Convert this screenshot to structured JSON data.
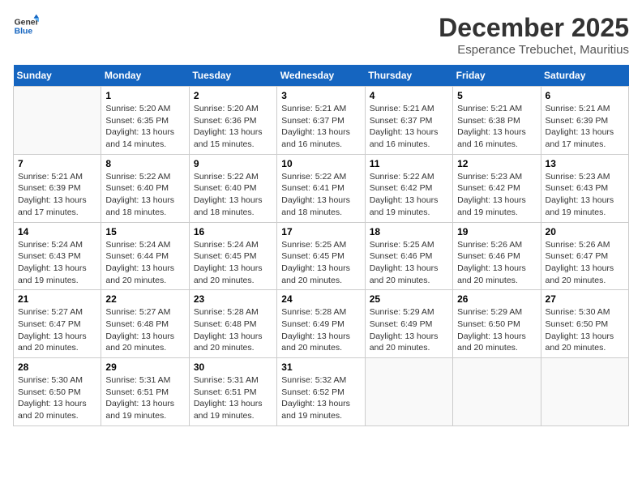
{
  "logo": {
    "line1": "General",
    "line2": "Blue"
  },
  "title": "December 2025",
  "subtitle": "Esperance Trebuchet, Mauritius",
  "weekdays": [
    "Sunday",
    "Monday",
    "Tuesday",
    "Wednesday",
    "Thursday",
    "Friday",
    "Saturday"
  ],
  "weeks": [
    [
      {
        "day": "",
        "info": ""
      },
      {
        "day": "1",
        "info": "Sunrise: 5:20 AM\nSunset: 6:35 PM\nDaylight: 13 hours\nand 14 minutes."
      },
      {
        "day": "2",
        "info": "Sunrise: 5:20 AM\nSunset: 6:36 PM\nDaylight: 13 hours\nand 15 minutes."
      },
      {
        "day": "3",
        "info": "Sunrise: 5:21 AM\nSunset: 6:37 PM\nDaylight: 13 hours\nand 16 minutes."
      },
      {
        "day": "4",
        "info": "Sunrise: 5:21 AM\nSunset: 6:37 PM\nDaylight: 13 hours\nand 16 minutes."
      },
      {
        "day": "5",
        "info": "Sunrise: 5:21 AM\nSunset: 6:38 PM\nDaylight: 13 hours\nand 16 minutes."
      },
      {
        "day": "6",
        "info": "Sunrise: 5:21 AM\nSunset: 6:39 PM\nDaylight: 13 hours\nand 17 minutes."
      }
    ],
    [
      {
        "day": "7",
        "info": "Sunrise: 5:21 AM\nSunset: 6:39 PM\nDaylight: 13 hours\nand 17 minutes."
      },
      {
        "day": "8",
        "info": "Sunrise: 5:22 AM\nSunset: 6:40 PM\nDaylight: 13 hours\nand 18 minutes."
      },
      {
        "day": "9",
        "info": "Sunrise: 5:22 AM\nSunset: 6:40 PM\nDaylight: 13 hours\nand 18 minutes."
      },
      {
        "day": "10",
        "info": "Sunrise: 5:22 AM\nSunset: 6:41 PM\nDaylight: 13 hours\nand 18 minutes."
      },
      {
        "day": "11",
        "info": "Sunrise: 5:22 AM\nSunset: 6:42 PM\nDaylight: 13 hours\nand 19 minutes."
      },
      {
        "day": "12",
        "info": "Sunrise: 5:23 AM\nSunset: 6:42 PM\nDaylight: 13 hours\nand 19 minutes."
      },
      {
        "day": "13",
        "info": "Sunrise: 5:23 AM\nSunset: 6:43 PM\nDaylight: 13 hours\nand 19 minutes."
      }
    ],
    [
      {
        "day": "14",
        "info": "Sunrise: 5:24 AM\nSunset: 6:43 PM\nDaylight: 13 hours\nand 19 minutes."
      },
      {
        "day": "15",
        "info": "Sunrise: 5:24 AM\nSunset: 6:44 PM\nDaylight: 13 hours\nand 20 minutes."
      },
      {
        "day": "16",
        "info": "Sunrise: 5:24 AM\nSunset: 6:45 PM\nDaylight: 13 hours\nand 20 minutes."
      },
      {
        "day": "17",
        "info": "Sunrise: 5:25 AM\nSunset: 6:45 PM\nDaylight: 13 hours\nand 20 minutes."
      },
      {
        "day": "18",
        "info": "Sunrise: 5:25 AM\nSunset: 6:46 PM\nDaylight: 13 hours\nand 20 minutes."
      },
      {
        "day": "19",
        "info": "Sunrise: 5:26 AM\nSunset: 6:46 PM\nDaylight: 13 hours\nand 20 minutes."
      },
      {
        "day": "20",
        "info": "Sunrise: 5:26 AM\nSunset: 6:47 PM\nDaylight: 13 hours\nand 20 minutes."
      }
    ],
    [
      {
        "day": "21",
        "info": "Sunrise: 5:27 AM\nSunset: 6:47 PM\nDaylight: 13 hours\nand 20 minutes."
      },
      {
        "day": "22",
        "info": "Sunrise: 5:27 AM\nSunset: 6:48 PM\nDaylight: 13 hours\nand 20 minutes."
      },
      {
        "day": "23",
        "info": "Sunrise: 5:28 AM\nSunset: 6:48 PM\nDaylight: 13 hours\nand 20 minutes."
      },
      {
        "day": "24",
        "info": "Sunrise: 5:28 AM\nSunset: 6:49 PM\nDaylight: 13 hours\nand 20 minutes."
      },
      {
        "day": "25",
        "info": "Sunrise: 5:29 AM\nSunset: 6:49 PM\nDaylight: 13 hours\nand 20 minutes."
      },
      {
        "day": "26",
        "info": "Sunrise: 5:29 AM\nSunset: 6:50 PM\nDaylight: 13 hours\nand 20 minutes."
      },
      {
        "day": "27",
        "info": "Sunrise: 5:30 AM\nSunset: 6:50 PM\nDaylight: 13 hours\nand 20 minutes."
      }
    ],
    [
      {
        "day": "28",
        "info": "Sunrise: 5:30 AM\nSunset: 6:50 PM\nDaylight: 13 hours\nand 20 minutes."
      },
      {
        "day": "29",
        "info": "Sunrise: 5:31 AM\nSunset: 6:51 PM\nDaylight: 13 hours\nand 19 minutes."
      },
      {
        "day": "30",
        "info": "Sunrise: 5:31 AM\nSunset: 6:51 PM\nDaylight: 13 hours\nand 19 minutes."
      },
      {
        "day": "31",
        "info": "Sunrise: 5:32 AM\nSunset: 6:52 PM\nDaylight: 13 hours\nand 19 minutes."
      },
      {
        "day": "",
        "info": ""
      },
      {
        "day": "",
        "info": ""
      },
      {
        "day": "",
        "info": ""
      }
    ]
  ]
}
